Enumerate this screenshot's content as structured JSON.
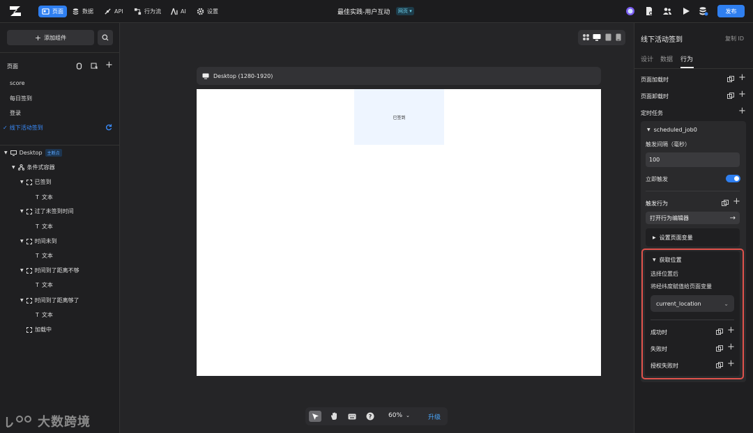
{
  "topbar": {
    "nav": [
      {
        "label": "页面",
        "icon": "page-icon"
      },
      {
        "label": "数据",
        "icon": "database-icon"
      },
      {
        "label": "API",
        "icon": "api-icon"
      },
      {
        "label": "行为流",
        "icon": "flow-icon"
      },
      {
        "label": "AI",
        "icon": "ai-icon"
      },
      {
        "label": "设置",
        "icon": "gear-icon"
      }
    ],
    "title": "最佳实践-用户互动",
    "env_badge": "网页",
    "publish_label": "发布",
    "accent": "#2f7ff0"
  },
  "left": {
    "add_component": "添加组件",
    "pages_title": "页面",
    "pages": [
      "score",
      "每日签到",
      "登录",
      "线下活动签到"
    ],
    "tree": {
      "root": "Desktop",
      "root_tag": "主断点",
      "container": "条件式容器",
      "states": [
        {
          "label": "已签到",
          "child": "文本"
        },
        {
          "label": "过了未签到时间",
          "child": "文本"
        },
        {
          "label": "时间未到",
          "child": "文本"
        },
        {
          "label": "时间到了距离不够",
          "child": "文本"
        },
        {
          "label": "时间到了距离够了",
          "child": "文本"
        }
      ],
      "loading": "加载中"
    },
    "watermark": "大数跨境"
  },
  "canvas": {
    "device_label": "Desktop (1280-1920)",
    "signed_text": "已签到",
    "zoom": "60%",
    "upgrade": "升级"
  },
  "right": {
    "title": "线下活动签到",
    "copy_id": "复制 ID",
    "tabs": [
      "设计",
      "数据",
      "行为"
    ],
    "active_tab": "行为",
    "on_load": "页面加载时",
    "on_unload": "页面卸载时",
    "timer_tasks": "定时任务",
    "job": {
      "name": "scheduled_job0",
      "interval_label": "触发间隔（毫秒）",
      "interval_value": "100",
      "immediate_label": "立即触发",
      "immediate_on": true,
      "trigger_label": "触发行为",
      "open_editor": "打开行为编辑器",
      "set_var": "设置页面变量",
      "get_location": {
        "title": "获取位置",
        "desc1": "选择位置后",
        "desc2": "将经纬度赋值给页面变量",
        "selected": "current_location",
        "on_success": "成功时",
        "on_fail": "失败时",
        "on_auth_fail": "授权失败时"
      }
    },
    "highlight_color": "#e0524c"
  }
}
